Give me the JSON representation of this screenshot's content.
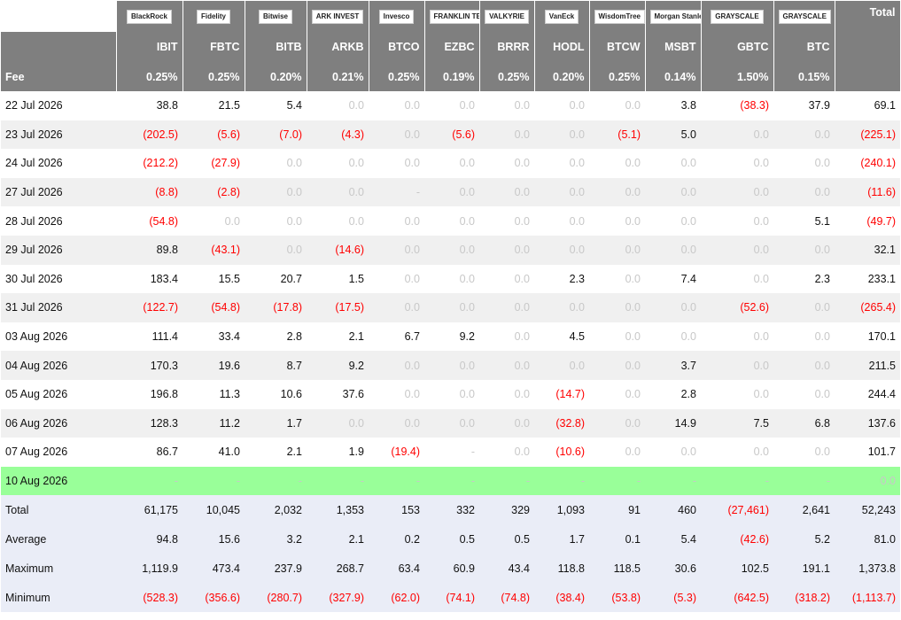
{
  "header": {
    "total_label": "Total",
    "fee_label": "Fee",
    "funds": [
      {
        "logo": "BlackRock",
        "ticker": "IBIT",
        "fee": "0.25%"
      },
      {
        "logo": "Fidelity",
        "ticker": "FBTC",
        "fee": "0.25%"
      },
      {
        "logo": "Bitwise",
        "ticker": "BITB",
        "fee": "0.20%"
      },
      {
        "logo": "ARK INVEST",
        "ticker": "ARKB",
        "fee": "0.21%"
      },
      {
        "logo": "Invesco",
        "ticker": "BTCO",
        "fee": "0.25%"
      },
      {
        "logo": "FRANKLIN TEMPLETON",
        "ticker": "EZBC",
        "fee": "0.19%"
      },
      {
        "logo": "VALKYRIE",
        "ticker": "BRRR",
        "fee": "0.25%"
      },
      {
        "logo": "VanEck",
        "ticker": "HODL",
        "fee": "0.20%"
      },
      {
        "logo": "WisdomTree",
        "ticker": "BTCW",
        "fee": "0.25%"
      },
      {
        "logo": "Morgan Stanley",
        "ticker": "MSBT",
        "fee": "0.14%"
      },
      {
        "logo": "GRAYSCALE",
        "ticker": "GBTC",
        "fee": "1.50%"
      },
      {
        "logo": "GRAYSCALE",
        "ticker": "BTC",
        "fee": "0.15%"
      }
    ]
  },
  "rows": [
    {
      "date": "22 Jul 2026",
      "values": [
        "38.8",
        "21.5",
        "5.4",
        "0.0",
        "0.0",
        "0.0",
        "0.0",
        "0.0",
        "0.0",
        "3.8",
        "(38.3)",
        "37.9"
      ],
      "total": "69.1"
    },
    {
      "date": "23 Jul 2026",
      "values": [
        "(202.5)",
        "(5.6)",
        "(7.0)",
        "(4.3)",
        "0.0",
        "(5.6)",
        "0.0",
        "0.0",
        "(5.1)",
        "5.0",
        "0.0",
        "0.0"
      ],
      "total": "(225.1)"
    },
    {
      "date": "24 Jul 2026",
      "values": [
        "(212.2)",
        "(27.9)",
        "0.0",
        "0.0",
        "0.0",
        "0.0",
        "0.0",
        "0.0",
        "0.0",
        "0.0",
        "0.0",
        "0.0"
      ],
      "total": "(240.1)"
    },
    {
      "date": "27 Jul 2026",
      "values": [
        "(8.8)",
        "(2.8)",
        "0.0",
        "0.0",
        "-",
        "0.0",
        "0.0",
        "0.0",
        "0.0",
        "0.0",
        "0.0",
        "0.0"
      ],
      "total": "(11.6)"
    },
    {
      "date": "28 Jul 2026",
      "values": [
        "(54.8)",
        "0.0",
        "0.0",
        "0.0",
        "0.0",
        "0.0",
        "0.0",
        "0.0",
        "0.0",
        "0.0",
        "0.0",
        "5.1"
      ],
      "total": "(49.7)"
    },
    {
      "date": "29 Jul 2026",
      "values": [
        "89.8",
        "(43.1)",
        "0.0",
        "(14.6)",
        "0.0",
        "0.0",
        "0.0",
        "0.0",
        "0.0",
        "0.0",
        "0.0",
        "0.0"
      ],
      "total": "32.1"
    },
    {
      "date": "30 Jul 2026",
      "values": [
        "183.4",
        "15.5",
        "20.7",
        "1.5",
        "0.0",
        "0.0",
        "0.0",
        "2.3",
        "0.0",
        "7.4",
        "0.0",
        "2.3"
      ],
      "total": "233.1"
    },
    {
      "date": "31 Jul 2026",
      "values": [
        "(122.7)",
        "(54.8)",
        "(17.8)",
        "(17.5)",
        "0.0",
        "0.0",
        "0.0",
        "0.0",
        "0.0",
        "0.0",
        "(52.6)",
        "0.0"
      ],
      "total": "(265.4)"
    },
    {
      "date": "03 Aug 2026",
      "values": [
        "111.4",
        "33.4",
        "2.8",
        "2.1",
        "6.7",
        "9.2",
        "0.0",
        "4.5",
        "0.0",
        "0.0",
        "0.0",
        "0.0"
      ],
      "total": "170.1"
    },
    {
      "date": "04 Aug 2026",
      "values": [
        "170.3",
        "19.6",
        "8.7",
        "9.2",
        "0.0",
        "0.0",
        "0.0",
        "0.0",
        "0.0",
        "3.7",
        "0.0",
        "0.0"
      ],
      "total": "211.5"
    },
    {
      "date": "05 Aug 2026",
      "values": [
        "196.8",
        "11.3",
        "10.6",
        "37.6",
        "0.0",
        "0.0",
        "0.0",
        "(14.7)",
        "0.0",
        "2.8",
        "0.0",
        "0.0"
      ],
      "total": "244.4"
    },
    {
      "date": "06 Aug 2026",
      "values": [
        "128.3",
        "11.2",
        "1.7",
        "0.0",
        "0.0",
        "0.0",
        "0.0",
        "(32.8)",
        "0.0",
        "14.9",
        "7.5",
        "6.8"
      ],
      "total": "137.6"
    },
    {
      "date": "07 Aug 2026",
      "values": [
        "86.7",
        "41.0",
        "2.1",
        "1.9",
        "(19.4)",
        "-",
        "0.0",
        "(10.6)",
        "0.0",
        "0.0",
        "0.0",
        "0.0"
      ],
      "total": "101.7"
    },
    {
      "date": "10 Aug 2026",
      "values": [
        "-",
        "-",
        "-",
        "-",
        "-",
        "-",
        "-",
        "-",
        "-",
        "-",
        "-",
        "-"
      ],
      "total": "0.0",
      "highlight": true
    }
  ],
  "stats": [
    {
      "label": "Total",
      "values": [
        "61,175",
        "10,045",
        "2,032",
        "1,353",
        "153",
        "332",
        "329",
        "1,093",
        "91",
        "460",
        "(27,461)",
        "2,641"
      ],
      "total": "52,243"
    },
    {
      "label": "Average",
      "values": [
        "94.8",
        "15.6",
        "3.2",
        "2.1",
        "0.2",
        "0.5",
        "0.5",
        "1.7",
        "0.1",
        "5.4",
        "(42.6)",
        "5.2"
      ],
      "total": "81.0"
    },
    {
      "label": "Maximum",
      "values": [
        "1,119.9",
        "473.4",
        "237.9",
        "268.7",
        "63.4",
        "60.9",
        "43.4",
        "118.8",
        "118.5",
        "30.6",
        "102.5",
        "191.1"
      ],
      "total": "1,373.8"
    },
    {
      "label": "Minimum",
      "values": [
        "(528.3)",
        "(356.6)",
        "(280.7)",
        "(327.9)",
        "(62.0)",
        "(74.1)",
        "(74.8)",
        "(38.4)",
        "(53.8)",
        "(5.3)",
        "(642.5)",
        "(318.2)"
      ],
      "total": "(1,113.7)"
    }
  ]
}
